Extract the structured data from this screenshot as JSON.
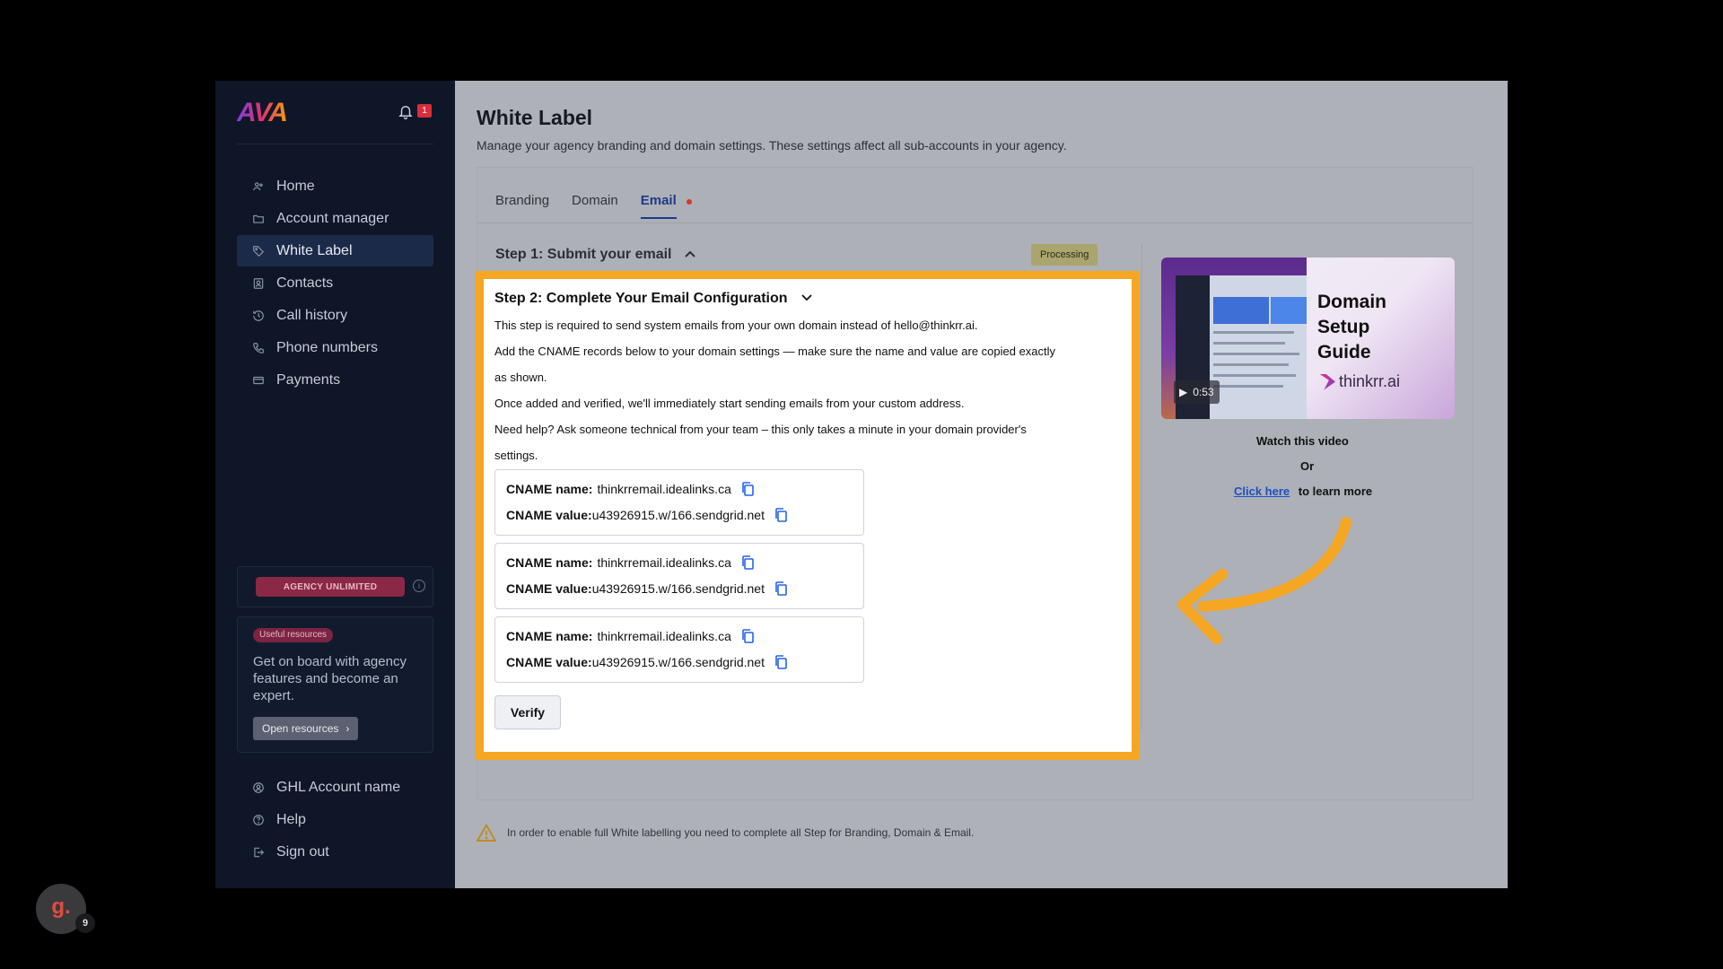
{
  "app": {
    "logo": "AVA",
    "notification_count": "1"
  },
  "sidebar": {
    "items": [
      {
        "label": "Home",
        "icon": "users-icon"
      },
      {
        "label": "Account manager",
        "icon": "folder-icon"
      },
      {
        "label": "White Label",
        "icon": "tag-icon",
        "active": true
      },
      {
        "label": "Contacts",
        "icon": "contacts-icon"
      },
      {
        "label": "Call history",
        "icon": "history-icon"
      },
      {
        "label": "Phone numbers",
        "icon": "phone-icon"
      },
      {
        "label": "Payments",
        "icon": "card-icon"
      }
    ],
    "plan": "AGENCY UNLIMITED",
    "resources": {
      "badge": "Useful resources",
      "text": "Get on board with agency features and become an expert.",
      "button": "Open resources"
    },
    "bottom_items": [
      {
        "label": "GHL Account name",
        "icon": "account-icon"
      },
      {
        "label": "Help",
        "icon": "help-icon"
      },
      {
        "label": "Sign out",
        "icon": "signout-icon"
      }
    ]
  },
  "page": {
    "title": "White Label",
    "subtitle": "Manage your agency branding and domain settings. These settings affect all sub-accounts in your agency.",
    "tabs": [
      "Branding",
      "Domain",
      "Email"
    ],
    "step1": {
      "title": "Step 1: Submit your email",
      "status": "Processing"
    },
    "step2": {
      "title": "Step 2: Complete Your Email Configuration",
      "lines": [
        "This step is required to send system emails from your own domain instead of hello@thinkrr.ai.",
        "Add the CNAME records below to your domain settings — make sure the name and value are copied exactly",
        "as shown.",
        "Once added and verified, we'll immediately start sending emails from your custom address.",
        "Need help? Ask someone technical from your team – this only takes a minute in your domain provider's",
        "settings."
      ],
      "records": [
        {
          "name_label": "CNAME name:",
          "name": "thinkrremail.idealinks.ca",
          "value_label": "CNAME value:",
          "value": "u43926915.w/166.sendgrid.net"
        },
        {
          "name_label": "CNAME name:",
          "name": "thinkrremail.idealinks.ca",
          "value_label": "CNAME value:",
          "value": "u43926915.w/166.sendgrid.net"
        },
        {
          "name_label": "CNAME name:",
          "name": "thinkrremail.idealinks.ca",
          "value_label": "CNAME value:",
          "value": "u43926915.w/166.sendgrid.net"
        }
      ],
      "verify": "Verify"
    },
    "video": {
      "title": "Domain Setup Guide",
      "brand": "thinkrr.ai",
      "duration": "0:53"
    },
    "watch": "Watch this video",
    "or": "Or",
    "learn_link": "Click here",
    "learn_text": "to learn more",
    "warning": "In order to enable full White labelling you need to complete all Step for Branding, Domain & Email."
  },
  "overlay": {
    "avatar": "g.",
    "avatar_count": "9"
  },
  "colors": {
    "highlight": "#f5a623",
    "sidebar": "#0f1627",
    "link": "#1d4fc4"
  }
}
